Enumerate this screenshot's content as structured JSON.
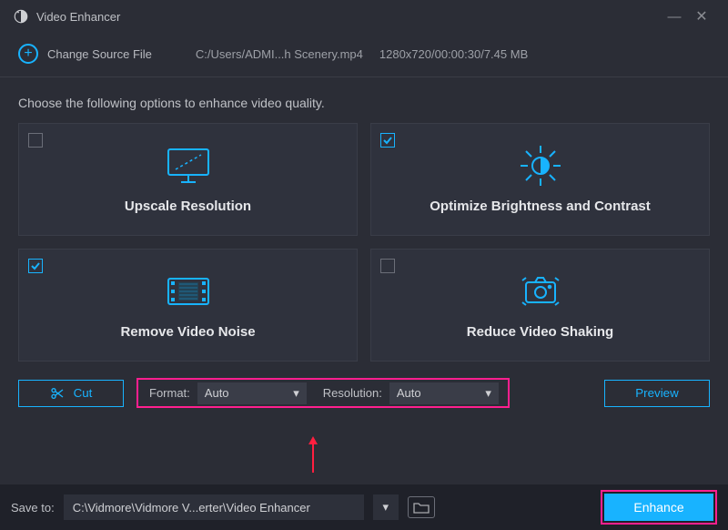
{
  "app": {
    "title": "Video Enhancer"
  },
  "source": {
    "change_label": "Change Source File",
    "path": "C:/Users/ADMI...h Scenery.mp4",
    "meta": "1280x720/00:00:30/7.45 MB"
  },
  "instruction": "Choose the following options to enhance video quality.",
  "options": [
    {
      "key": "upscale",
      "label": "Upscale Resolution",
      "checked": false
    },
    {
      "key": "optimize",
      "label": "Optimize Brightness and Contrast",
      "checked": true
    },
    {
      "key": "denoise",
      "label": "Remove Video Noise",
      "checked": true
    },
    {
      "key": "deshake",
      "label": "Reduce Video Shaking",
      "checked": false
    }
  ],
  "controls": {
    "cut_label": "Cut",
    "format_label": "Format:",
    "format_value": "Auto",
    "resolution_label": "Resolution:",
    "resolution_value": "Auto",
    "preview_label": "Preview"
  },
  "save": {
    "label": "Save to:",
    "path": "C:\\Vidmore\\Vidmore V...erter\\Video Enhancer",
    "enhance_label": "Enhance"
  },
  "colors": {
    "accent": "#18b3ff",
    "highlight": "#ff1f8f"
  }
}
